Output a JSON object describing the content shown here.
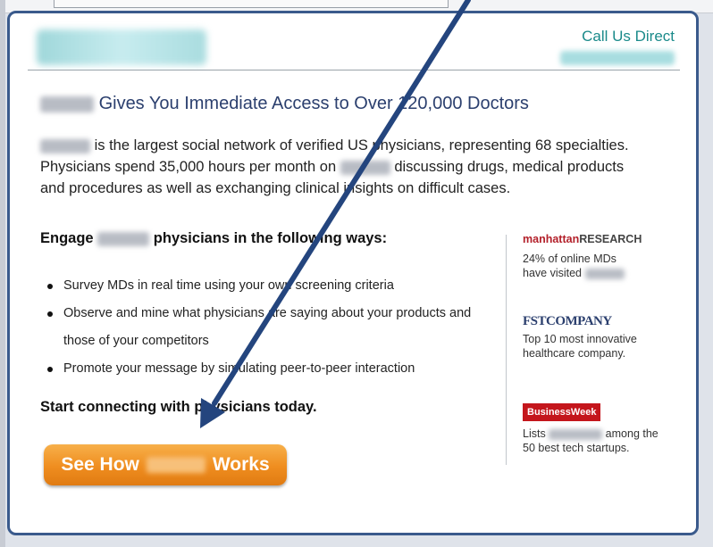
{
  "header": {
    "call_label": "Call Us Direct"
  },
  "headline": {
    "text": "Gives You Immediate Access to Over 120,000 Doctors"
  },
  "intro": {
    "line1": "is the largest social network of verified US physicians, representing 68 specialties.",
    "line2_a": "Physicians spend 35,000 hours per month on",
    "line2_b": "discussing drugs, medical products",
    "line3": "and procedures as well as exchanging clinical insights on difficult cases."
  },
  "engage": {
    "prefix": "Engage",
    "suffix": "physicians in the following ways:"
  },
  "bullets": [
    "Survey MDs in real time using your own screening criteria",
    "Observe and mine what physicians are saying about your products and those of your competitors",
    "Promote your message by simulating peer-to-peer interaction"
  ],
  "start_text": "Start connecting with physicians today.",
  "cta": {
    "prefix": "See How",
    "suffix": "Works"
  },
  "sidebar": {
    "manhattan": {
      "logo_a": "manhattan",
      "logo_b": "RESEARCH",
      "line1": "24% of online MDs",
      "line2": "have visited"
    },
    "fastcompany": {
      "logo": "FSTCOMPANY",
      "line1": "Top 10 most innovative",
      "line2": "healthcare company."
    },
    "businessweek": {
      "logo": "BusinessWeek",
      "line1_a": "Lists",
      "line1_b": "among the",
      "line2": "50 best tech startups."
    }
  },
  "colors": {
    "border": "#3a5a8c",
    "headline": "#2b3f6e",
    "call_label": "#1a8a8a",
    "cta_orange": "#ef8d1f",
    "arrow": "#24457e"
  }
}
